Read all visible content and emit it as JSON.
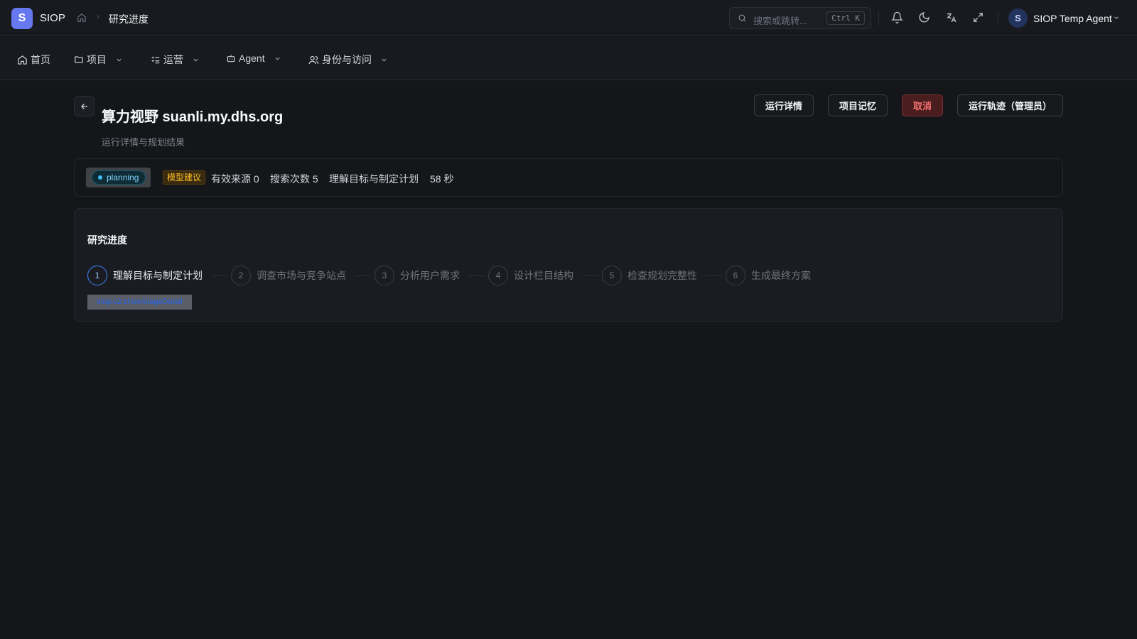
{
  "topbar": {
    "logo_letter": "S",
    "app_name": "SIOP",
    "breadcrumb_current": "研究进度",
    "search_placeholder": "搜索或跳转...",
    "search_shortcut": "Ctrl K",
    "user_avatar_letter": "S",
    "user_name": "SIOP Temp Agent"
  },
  "nav": {
    "items": [
      {
        "label": "首页",
        "icon": "home-icon"
      },
      {
        "label": "项目",
        "icon": "folder-icon"
      },
      {
        "label": "运营",
        "icon": "list-icon"
      },
      {
        "label": "Agent",
        "icon": "bot-icon"
      },
      {
        "label": "身份与访问",
        "icon": "users-icon"
      }
    ]
  },
  "header": {
    "title": "算力视野 suanli.my.dhs.org",
    "subtitle": "运行详情与规划结果",
    "buttons": {
      "run_details": "运行详情",
      "project_memory": "项目记忆",
      "cancel": "取消",
      "run_trace": "运行轨迹（管理员）"
    }
  },
  "status": {
    "state": "planning",
    "model_badge": "模型建议",
    "valid_sources": "有效来源 0",
    "search_count": "搜索次数 5",
    "current_stage": "理解目标与制定计划",
    "elapsed": "58 秒"
  },
  "progress": {
    "title": "研究进度",
    "steps": [
      {
        "num": "1",
        "label": "理解目标与制定计划",
        "active": true
      },
      {
        "num": "2",
        "label": "调查市场与竞争站点",
        "active": false
      },
      {
        "num": "3",
        "label": "分析用户需求",
        "active": false
      },
      {
        "num": "4",
        "label": "设计栏目结构",
        "active": false
      },
      {
        "num": "5",
        "label": "检查规划完整性",
        "active": false
      },
      {
        "num": "6",
        "label": "生成最终方案",
        "active": false
      }
    ],
    "stage_detail_tag": "siop.v2.showStageDetail"
  },
  "colors": {
    "background": "#151619",
    "accent": "#6678f0",
    "active_step": "#3b82f6",
    "danger": "#f87171",
    "planning": "#38bdf8",
    "warning": "#fbbf24"
  }
}
